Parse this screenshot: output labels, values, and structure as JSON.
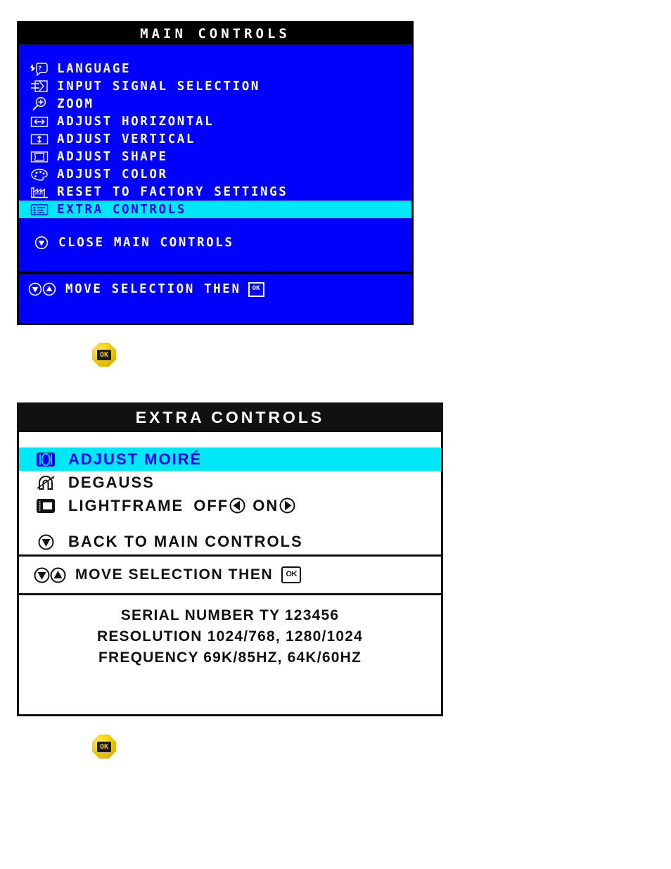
{
  "main_panel": {
    "title": "MAIN CONTROLS",
    "items": [
      {
        "icon": "language-icon",
        "label": "LANGUAGE",
        "selected": false
      },
      {
        "icon": "input-signal-icon",
        "label": "INPUT SIGNAL SELECTION",
        "selected": false
      },
      {
        "icon": "zoom-icon",
        "label": "ZOOM",
        "selected": false
      },
      {
        "icon": "adjust-horizontal-icon",
        "label": "ADJUST HORIZONTAL",
        "selected": false
      },
      {
        "icon": "adjust-vertical-icon",
        "label": "ADJUST VERTICAL",
        "selected": false
      },
      {
        "icon": "adjust-shape-icon",
        "label": "ADJUST SHAPE",
        "selected": false
      },
      {
        "icon": "adjust-color-icon",
        "label": "ADJUST COLOR",
        "selected": false
      },
      {
        "icon": "factory-reset-icon",
        "label": "RESET TO FACTORY SETTINGS",
        "selected": false
      },
      {
        "icon": "extra-controls-icon",
        "label": "EXTRA CONTROLS",
        "selected": true
      }
    ],
    "close_item": {
      "icon": "down-arrow-circle-icon",
      "label": "CLOSE MAIN CONTROLS"
    },
    "footer": {
      "label": "MOVE SELECTION THEN",
      "ok_glyph": "OK"
    },
    "colors": {
      "background": "#0000ff",
      "title_background": "#000000",
      "highlight_background": "#00e8f8",
      "highlight_text": "#0000ff",
      "text": "#ffffff"
    }
  },
  "ok_button_1": {
    "label": "OK"
  },
  "ok_button_2": {
    "label": "OK"
  },
  "extra_panel": {
    "title": "EXTRA CONTROLS",
    "items": [
      {
        "icon": "moire-icon",
        "label": "ADJUST MOIRÉ",
        "selected": true
      },
      {
        "icon": "degauss-icon",
        "label": "DEGAUSS",
        "selected": false
      }
    ],
    "lightframe": {
      "icon": "lightframe-icon",
      "label": "LIGHTFRAME",
      "off_label": "OFF",
      "on_label": "ON",
      "left_arrow": "left-arrow-circle-icon",
      "right_arrow": "right-arrow-circle-icon"
    },
    "back_item": {
      "icon": "down-arrow-circle-icon",
      "label": "BACK TO MAIN CONTROLS"
    },
    "footer": {
      "label": "MOVE SELECTION THEN",
      "ok_glyph": "OK"
    },
    "info": {
      "serial": "SERIAL NUMBER TY 123456",
      "resolution": "RESOLUTION 1024/768, 1280/1024",
      "frequency": "FREQUENCY 69K/85HZ, 64K/60HZ"
    },
    "colors": {
      "background": "#ffffff",
      "title_background": "#111111",
      "highlight_background": "#00e8f8",
      "highlight_text": "#0000ff",
      "text": "#111111"
    }
  }
}
